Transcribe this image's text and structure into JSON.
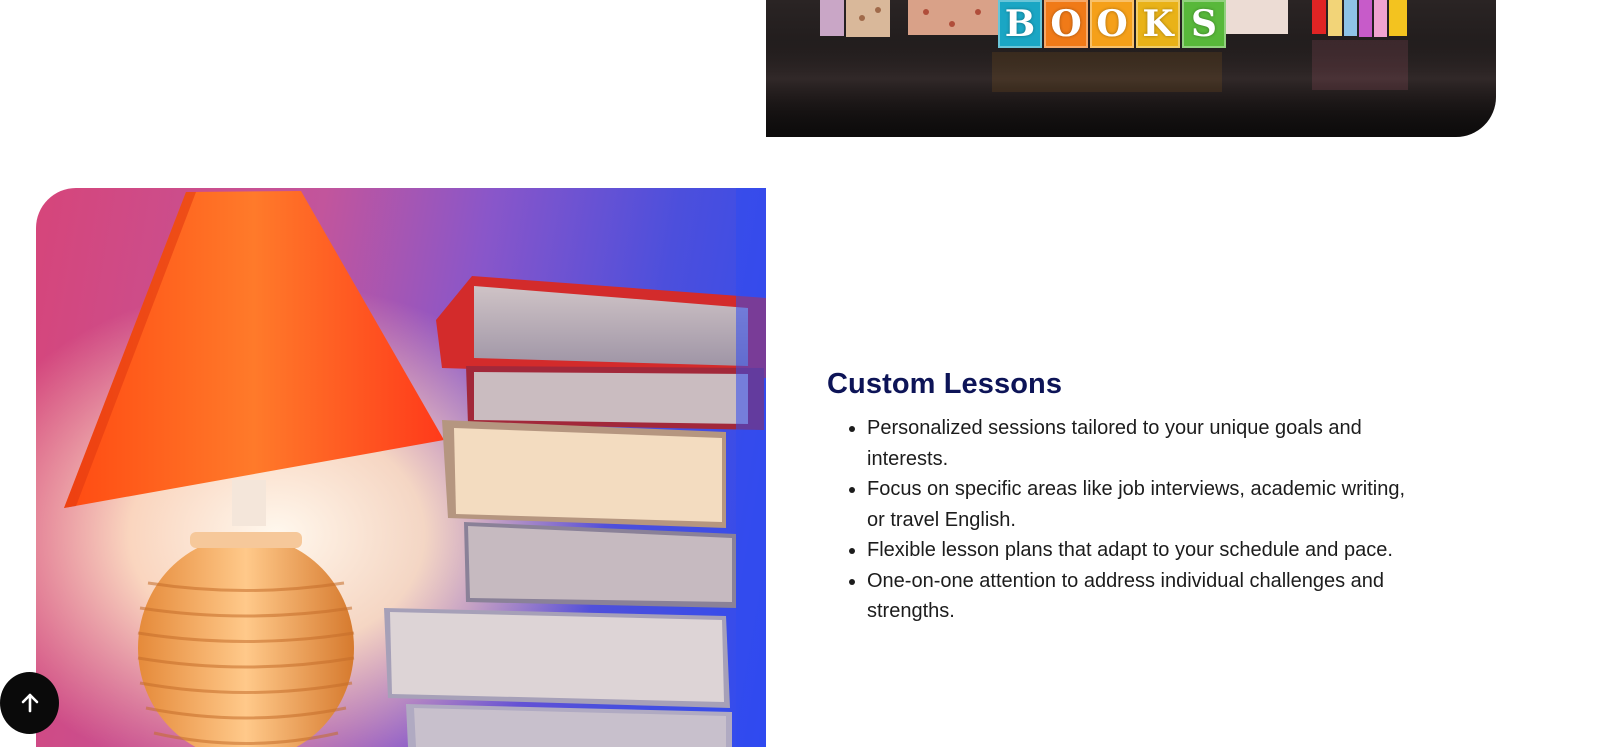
{
  "top_image": {
    "block_letters": [
      "B",
      "O",
      "O",
      "K",
      "S"
    ],
    "block_colors": [
      "#1aa6c4",
      "#f07a18",
      "#f5a019",
      "#e9b218",
      "#58b83a"
    ]
  },
  "lamp_image": {
    "alt": "Lamp and stack of books"
  },
  "section": {
    "title": "Custom Lessons",
    "items": [
      "Personalized sessions tailored to your unique goals and interests.",
      "Focus on specific areas like job interviews, academic writing, or travel English.",
      "Flexible lesson plans that adapt to your schedule and pace.",
      "One-on-one attention to address individual challenges and strengths."
    ]
  },
  "scroll_top": {
    "icon": "arrow-up-icon"
  },
  "colors": {
    "title": "#0d1457",
    "body_text": "#1c1c1c",
    "button_bg": "#0a0a0a"
  }
}
